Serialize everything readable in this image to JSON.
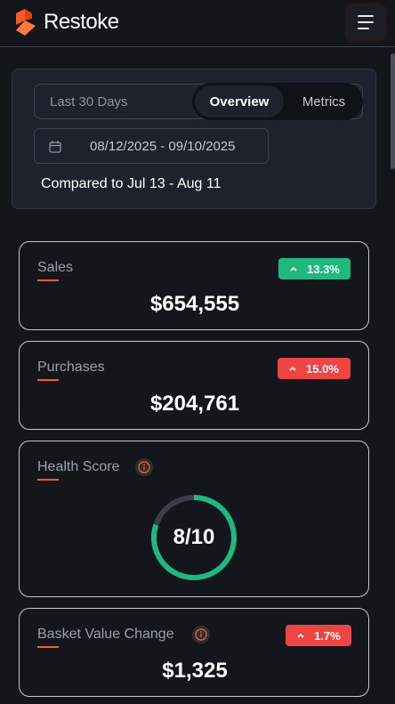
{
  "header": {
    "brand": "Restoke",
    "logo_color": "#ff5a1f",
    "menu_icon": "hamburger-menu-icon"
  },
  "filters": {
    "period": "Last 30 Days",
    "tabs": [
      {
        "label": "Overview",
        "active": true
      },
      {
        "label": "Metrics",
        "active": false
      }
    ],
    "date_range": "08/12/2025 - 09/10/2025",
    "date_icon": "calendar-icon",
    "comparison": "Compared to Jul 13 - Aug 11"
  },
  "cards": {
    "sales": {
      "title": "Sales",
      "value": "$654,555",
      "change": "13.3%",
      "change_direction": "up",
      "change_color": "#1fb97f"
    },
    "purchases": {
      "title": "Purchases",
      "value": "$204,761",
      "change": "15.0%",
      "change_direction": "up",
      "change_color": "#ef4444"
    },
    "health_score": {
      "title": "Health Score",
      "value": "8/10",
      "score": 8,
      "max": 10,
      "ring_color": "#1fb97f",
      "track_color": "#3a3f4a"
    },
    "basket_value": {
      "title": "Basket Value Change",
      "value": "$1,325",
      "change": "1.7%",
      "change_direction": "up",
      "change_color": "#ef4444"
    }
  },
  "colors": {
    "background": "#13161b",
    "accent": "#ff5a1f",
    "panel": "#1d222c"
  }
}
